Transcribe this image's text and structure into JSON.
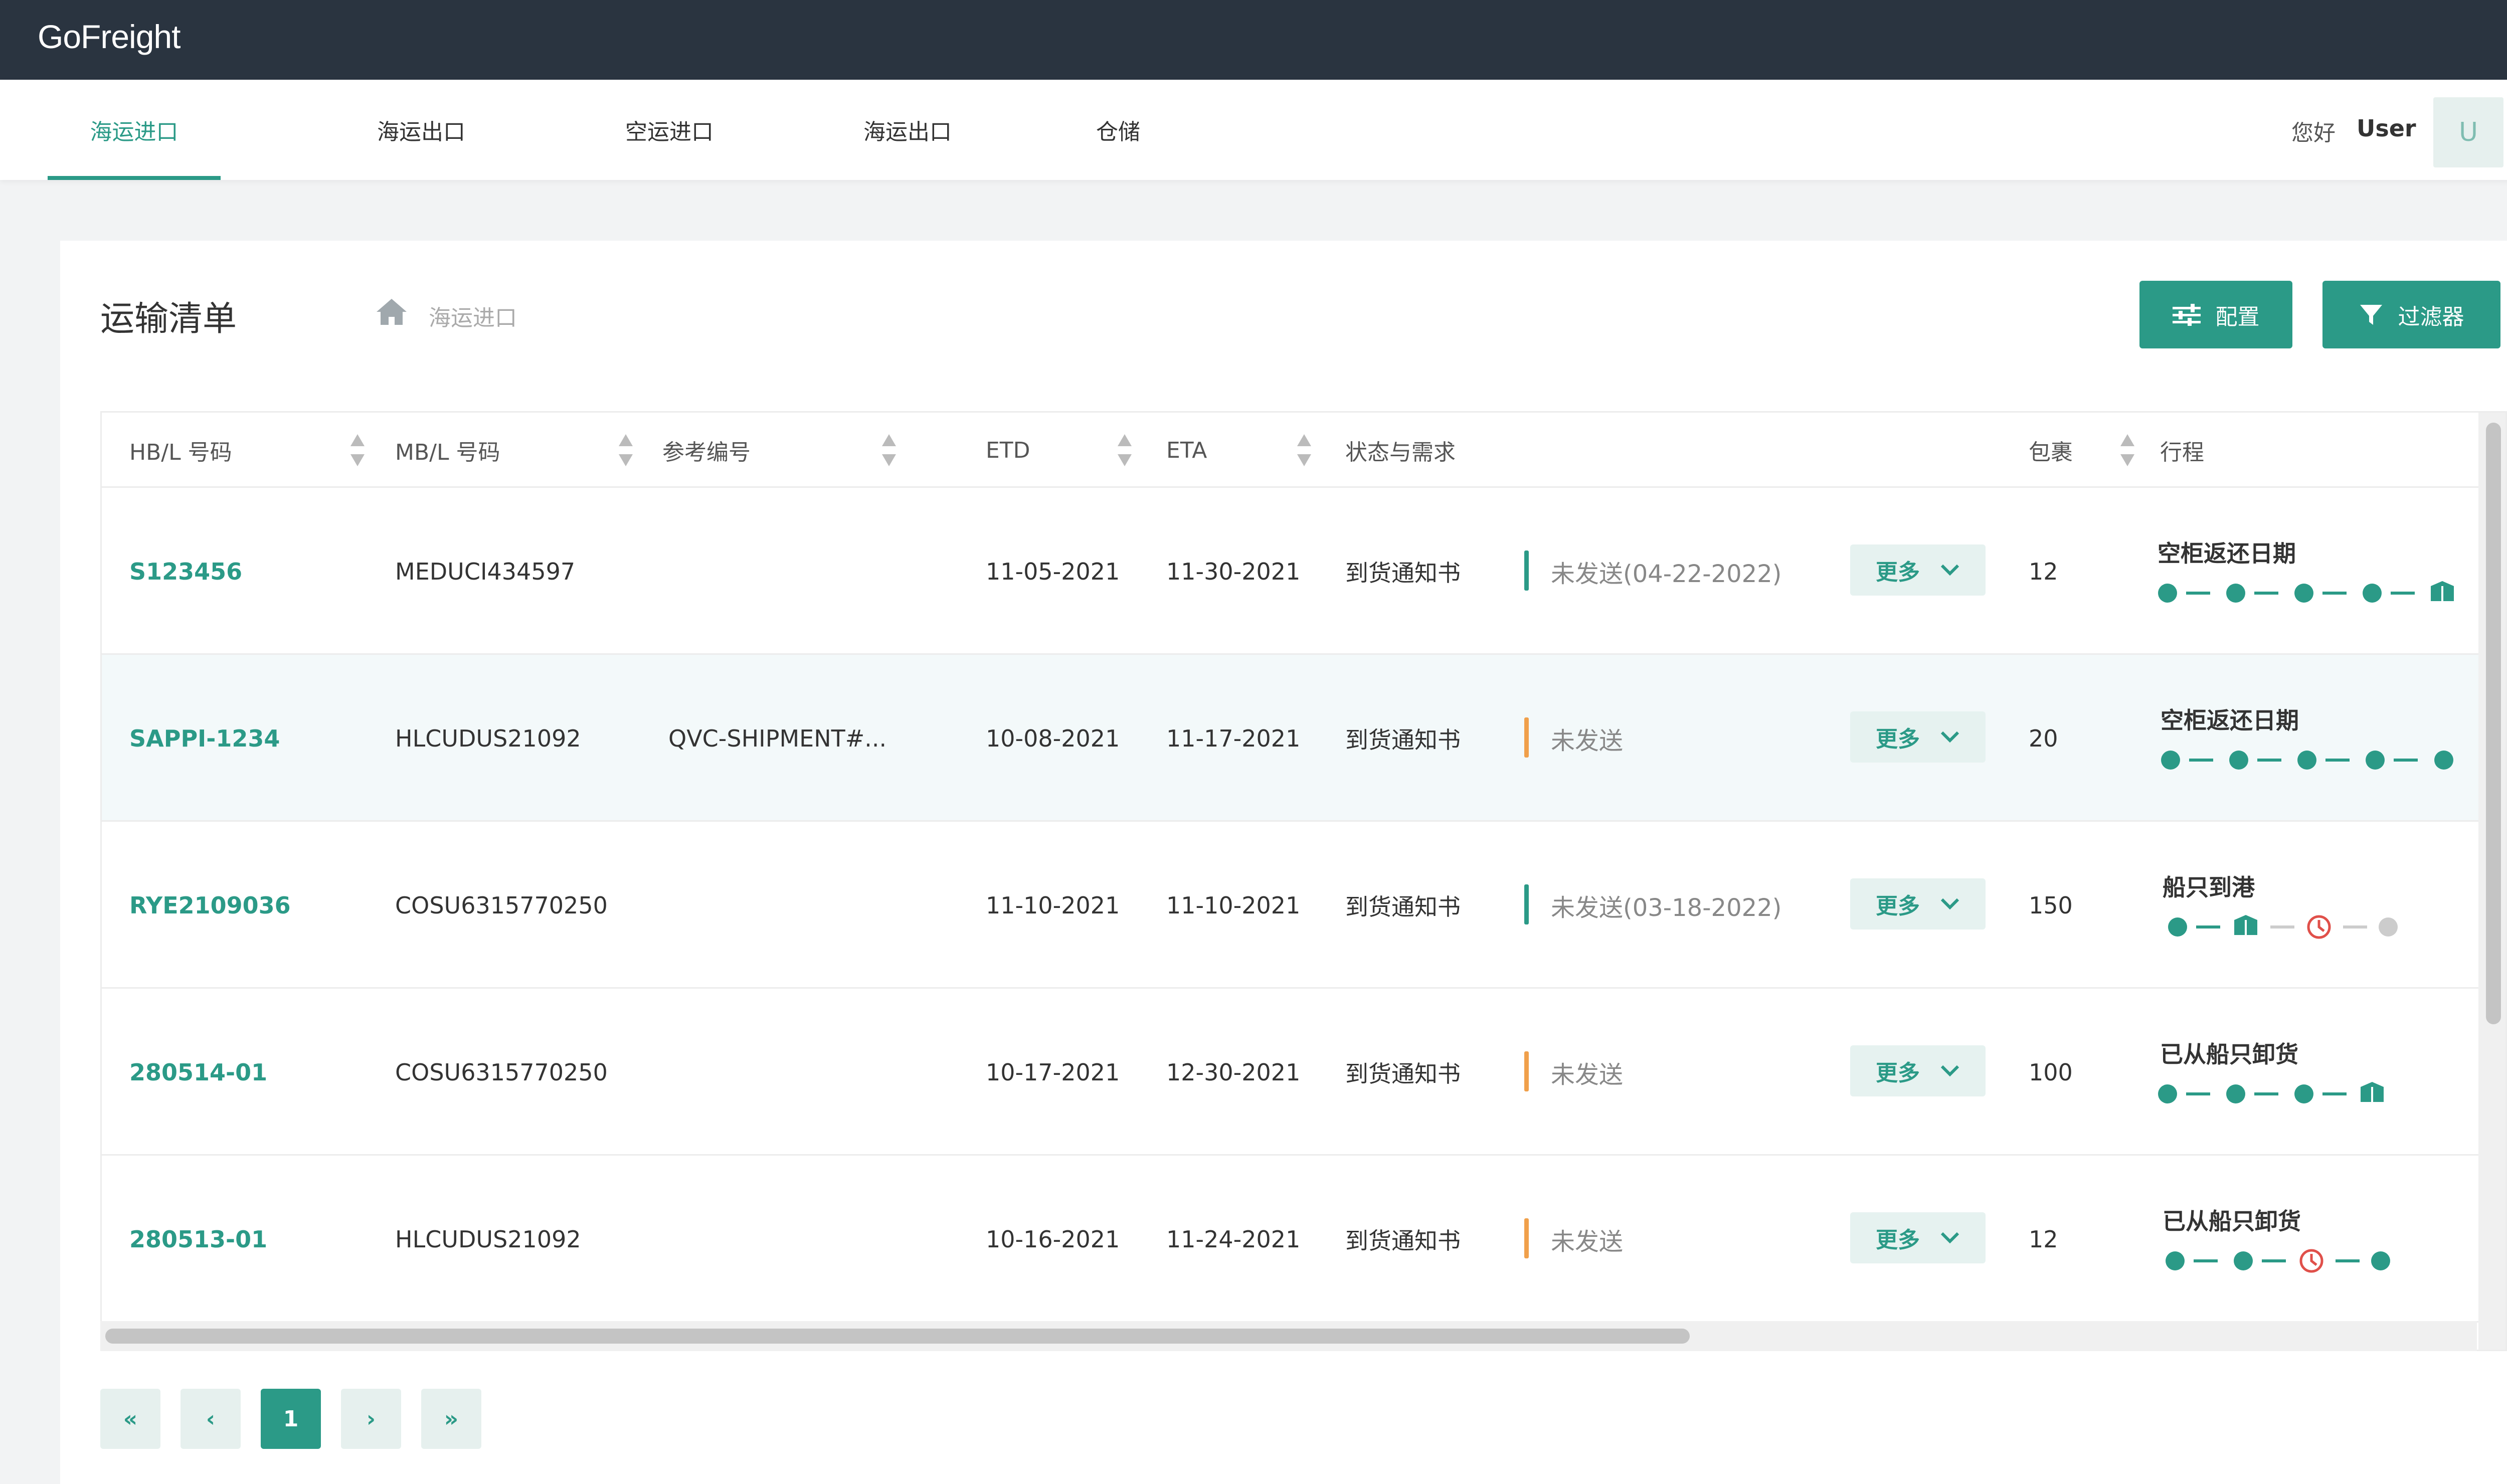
{
  "app": {
    "logo": "GoFreight"
  },
  "nav": {
    "tabs": [
      {
        "label": "海运进口",
        "active": true
      },
      {
        "label": "海运出口"
      },
      {
        "label": "空运进口"
      },
      {
        "label": "海运出口"
      },
      {
        "label": "仓储"
      }
    ],
    "greeting": "您好",
    "username": "User",
    "avatar_initial": "U"
  },
  "page": {
    "title": "运输清单",
    "breadcrumb": "海运进口",
    "config_label": "配置",
    "filter_label": "过滤器"
  },
  "table": {
    "headers": {
      "hbl": "HB/L 号码",
      "mbl": "MB/L 号码",
      "ref": "参考编号",
      "etd": "ETD",
      "eta": "ETA",
      "status": "状态与需求",
      "packages": "包裹",
      "route": "行程"
    },
    "more_label": "更多",
    "rows": [
      {
        "hbl": "S123456",
        "mbl": "MEDUCI434597",
        "ref": "",
        "etd": "11-05-2021",
        "eta": "11-30-2021",
        "doc": "到货通知书",
        "status": "未发送(04-22-2022)",
        "status_color": "#2b9a87",
        "packages": "12",
        "route_label": "空柜返还日期"
      },
      {
        "hbl": "SAPPI-1234",
        "mbl": "HLCUDUS21092",
        "ref": "QVC-SHIPMENT#...",
        "etd": "10-08-2021",
        "eta": "11-17-2021",
        "doc": "到货通知书",
        "status": "未发送",
        "status_color": "#f0a04b",
        "packages": "20",
        "route_label": "空柜返还日期"
      },
      {
        "hbl": "RYE2109036",
        "mbl": "COSU6315770250",
        "ref": "",
        "etd": "11-10-2021",
        "eta": "11-10-2021",
        "doc": "到货通知书",
        "status": "未发送(03-18-2022)",
        "status_color": "#2b9a87",
        "packages": "150",
        "route_label": "船只到港"
      },
      {
        "hbl": "280514-01",
        "mbl": "COSU6315770250",
        "ref": "",
        "etd": "10-17-2021",
        "eta": "12-30-2021",
        "doc": "到货通知书",
        "status": "未发送",
        "status_color": "#f0a04b",
        "packages": "100",
        "route_label": "已从船只卸货"
      },
      {
        "hbl": "280513-01",
        "mbl": "HLCUDUS21092",
        "ref": "",
        "etd": "10-16-2021",
        "eta": "11-24-2021",
        "doc": "到货通知书",
        "status": "未发送",
        "status_color": "#f0a04b",
        "packages": "12",
        "route_label": "已从船只卸货"
      }
    ]
  },
  "pagination": {
    "first": "«",
    "prev": "‹",
    "current": "1",
    "next": "›",
    "last": "»"
  },
  "colors": {
    "accent": "#2b9a87",
    "topbar": "#2a3440",
    "warning": "#f0a04b",
    "alert": "#e0504a"
  },
  "icons": {
    "home": "home-icon",
    "config": "sliders-icon",
    "filter": "filter-icon",
    "chevron": "chevron-down-icon",
    "package": "package-icon",
    "clock": "clock-icon"
  }
}
